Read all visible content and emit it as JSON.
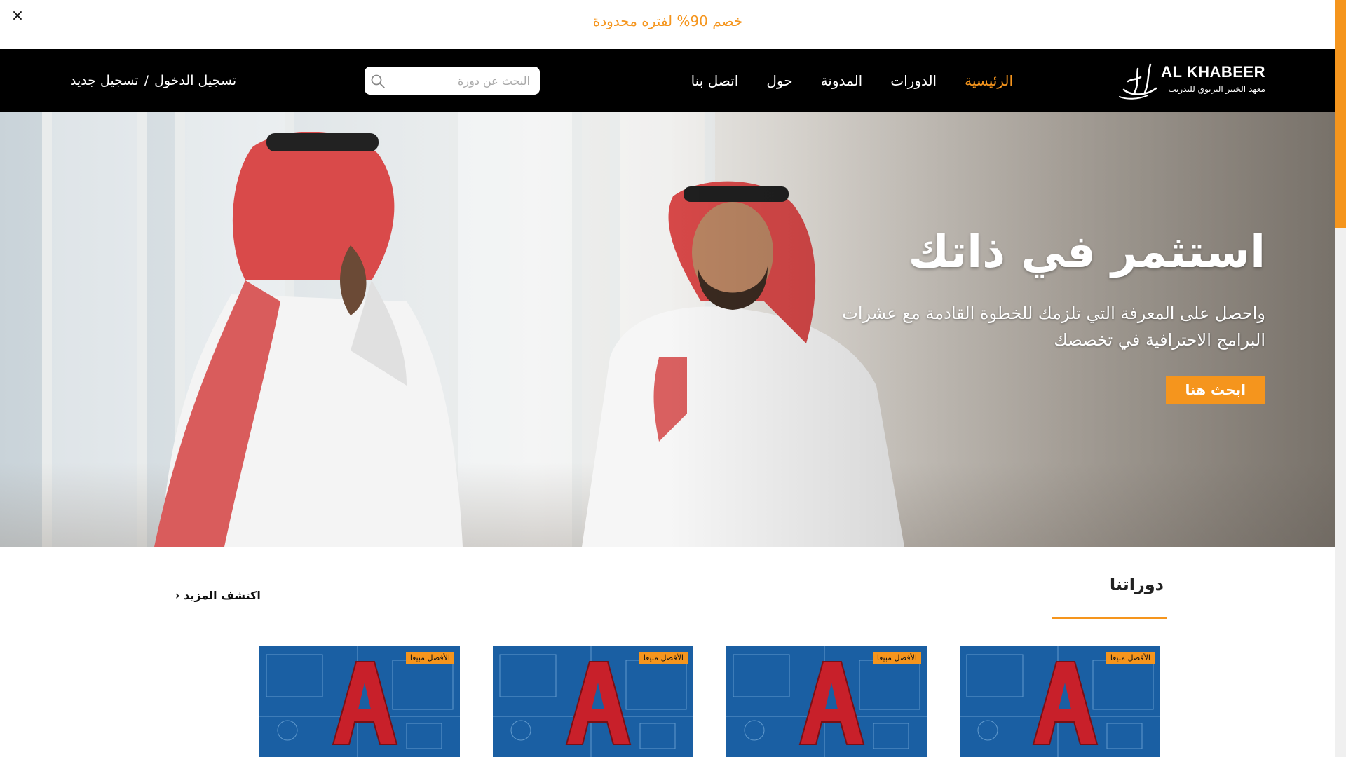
{
  "promo": {
    "text": "خصم 90% لفتره محدودة",
    "close_symbol": "×"
  },
  "logo": {
    "title": "AL KHABEER",
    "subtitle": "معهد الخبير التربوي للتدريب"
  },
  "nav": {
    "items": [
      {
        "label": "الرئيسية",
        "active": true
      },
      {
        "label": "الدورات",
        "active": false
      },
      {
        "label": "المدونة",
        "active": false
      },
      {
        "label": "حول",
        "active": false
      },
      {
        "label": "اتصل بنا",
        "active": false
      }
    ]
  },
  "search": {
    "placeholder": "البحث عن دورة",
    "icon": "search-icon"
  },
  "auth": {
    "login": "تسجيل الدخول",
    "separator": "/",
    "register": "تسجيل جديد"
  },
  "hero": {
    "title": "استثمر في ذاتك",
    "text": "واحصل على المعرفة التي تلزمك للخطوة القادمة مع عشرات البرامج الاحترافية في تخصصك",
    "button": "ابحث هنا"
  },
  "courses": {
    "title": "دوراتنا",
    "more": "اكتشف المزيد ‹",
    "cards": [
      {
        "badge": "الأفضل مبيعا",
        "icon": "autocad-logo-icon"
      },
      {
        "badge": "الأفضل مبيعا",
        "icon": "autocad-logo-icon"
      },
      {
        "badge": "الأفضل مبيعا",
        "icon": "autocad-logo-icon"
      },
      {
        "badge": "الأفضل مبيعا",
        "icon": "autocad-logo-icon"
      }
    ]
  },
  "colors": {
    "accent": "#f5951d",
    "nav_bg": "#000000",
    "card_bg": "#1a5fa3"
  }
}
